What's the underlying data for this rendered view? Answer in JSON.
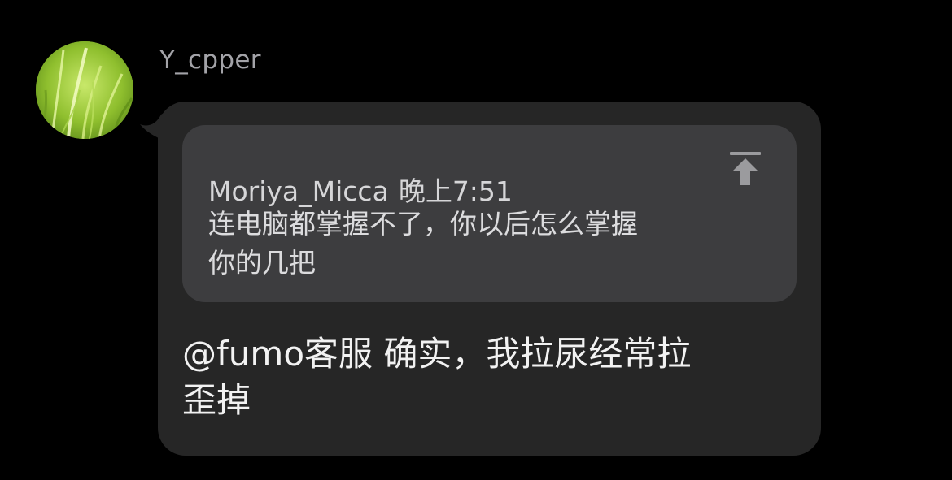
{
  "sender": {
    "name": "Y_cpper",
    "avatar_icon": "grass-avatar-icon"
  },
  "message": {
    "quote": {
      "author": "Moriya_Micca",
      "time": "晚上7:51",
      "text": "连电脑都掌握不了，你以后怎么掌握\n你的几把",
      "jump_icon": "jump-to-top-icon"
    },
    "text": "@fumo客服 确实，我拉尿经常拉\n歪掉"
  },
  "colors": {
    "background": "#000000",
    "bubble": "#262626",
    "quote_bg": "#3d3d3f",
    "name": "#a3a3a8",
    "text": "#f2f2f2"
  }
}
